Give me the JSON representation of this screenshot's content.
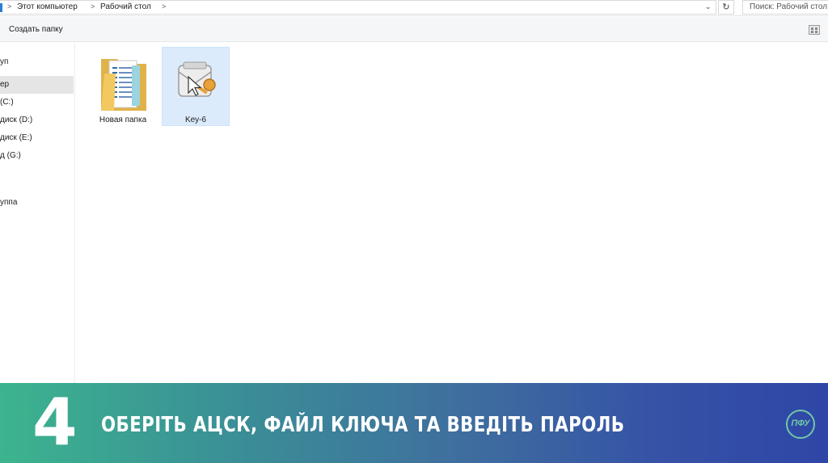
{
  "address_bar": {
    "breadcrumbs": [
      {
        "label": "Этот компьютер"
      },
      {
        "label": "Рабочий стол"
      }
    ],
    "dropdown_glyph": "⌄",
    "refresh_glyph": "↻",
    "search_placeholder": "Поиск: Рабочий стол"
  },
  "toolbar": {
    "new_folder_label": "Создать папку"
  },
  "sidebar": {
    "items": [
      {
        "label": "уп"
      },
      {
        "label": "ер"
      },
      {
        "label": "(C:)"
      },
      {
        "label": "диск (D:)"
      },
      {
        "label": "диск (E:)"
      },
      {
        "label": "д (G:)"
      },
      {
        "label": "уппа"
      }
    ],
    "selected_index": 1
  },
  "files": [
    {
      "label": "Новая папка",
      "icon": "folder-icon",
      "selected": false
    },
    {
      "label": "Key-6",
      "icon": "key-certificate-icon",
      "selected": true
    }
  ],
  "banner": {
    "step_number": "4",
    "step_text": "ОБЕРІТЬ АЦСК, ФАЙЛ КЛЮЧА ТА ВВЕДІТЬ ПАРОЛЬ",
    "logo_text": "ПФУ"
  },
  "colors": {
    "selection": "#dcebfb",
    "banner_start": "#3cb48e",
    "banner_end": "#2f46a6",
    "logo": "#6fc7a9"
  }
}
